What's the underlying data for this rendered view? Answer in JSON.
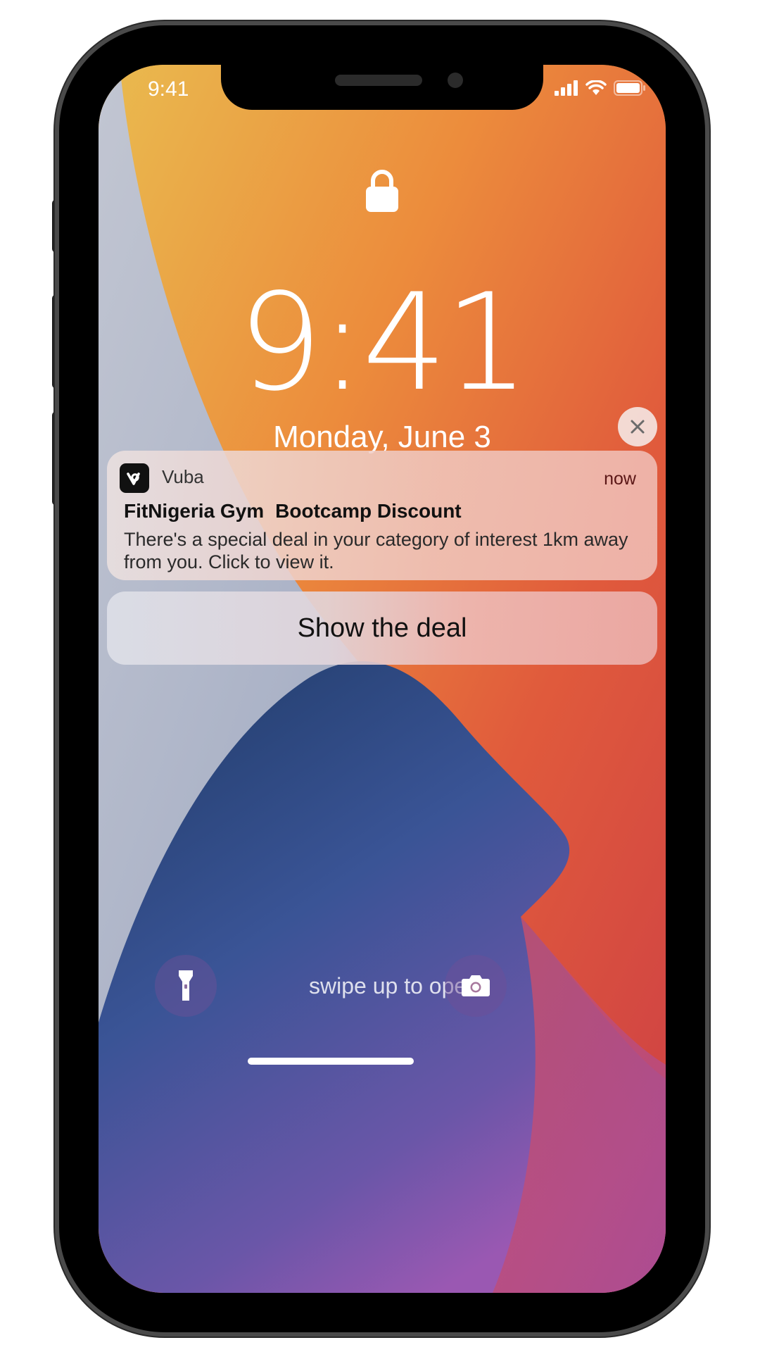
{
  "status_bar": {
    "time": "9:41",
    "icons": [
      "cellular-signal-icon",
      "wifi-icon",
      "battery-icon"
    ]
  },
  "lock_screen": {
    "lock_icon": "lock-icon",
    "time": "9:41",
    "date": "Monday, June 3"
  },
  "notification": {
    "app_name": "Vuba",
    "app_icon": "vuba-app-icon",
    "time": "now",
    "title_merchant": "FitNigeria Gym",
    "title_offer": "Bootcamp Discount",
    "body": "There's a special deal in your category of interest 1km away from you. Click to view it.",
    "close_icon": "close-icon"
  },
  "action": {
    "label": "Show the deal"
  },
  "bottom_controls": {
    "left_icon": "flashlight-icon",
    "right_icon": "camera-icon",
    "hint": "swipe up to open"
  },
  "colors": {
    "wallpaper_orange": "#ec8c3c",
    "wallpaper_red": "#d4443c",
    "wallpaper_navy": "#223c68",
    "wallpaper_purple": "#9c5ab4",
    "wallpaper_pale": "#b7bfd0",
    "notification_time_color": "#5a1616"
  }
}
